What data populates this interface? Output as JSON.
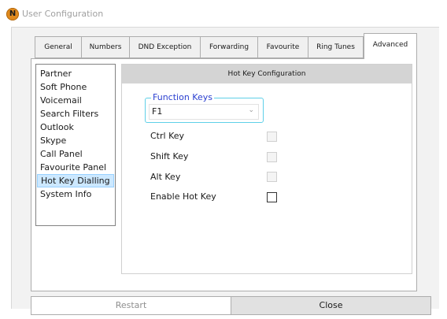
{
  "window": {
    "title": "User Configuration",
    "logo_letter": "N",
    "logo_color": "#e08a1e"
  },
  "tabs": [
    {
      "label": "General"
    },
    {
      "label": "Numbers"
    },
    {
      "label": "DND Exception"
    },
    {
      "label": "Forwarding"
    },
    {
      "label": "Favourite"
    },
    {
      "label": "Ring Tunes"
    },
    {
      "label": "Advanced",
      "active": true
    }
  ],
  "sidebar": {
    "items": [
      {
        "label": "Partner"
      },
      {
        "label": "Soft Phone"
      },
      {
        "label": "Voicemail"
      },
      {
        "label": "Search Filters"
      },
      {
        "label": "Outlook"
      },
      {
        "label": "Skype"
      },
      {
        "label": "Call Panel"
      },
      {
        "label": "Favourite Panel"
      },
      {
        "label": "Hot Key Dialling",
        "selected": true
      },
      {
        "label": "System Info"
      }
    ],
    "selected_color": "#cce8ff"
  },
  "hotkey": {
    "header": "Hot Key Configuration",
    "function_keys_label": "Function Keys",
    "function_key_value": "F1",
    "accent": "#2a3fd0",
    "group_border": "#5fd0e8",
    "options": [
      {
        "label": "Ctrl Key",
        "checked": false,
        "enabled": false
      },
      {
        "label": "Shift Key",
        "checked": false,
        "enabled": false
      },
      {
        "label": "Alt Key",
        "checked": false,
        "enabled": false
      },
      {
        "label": "Enable Hot Key",
        "checked": false,
        "enabled": true
      }
    ]
  },
  "buttons": {
    "restart": "Restart",
    "close": "Close"
  }
}
